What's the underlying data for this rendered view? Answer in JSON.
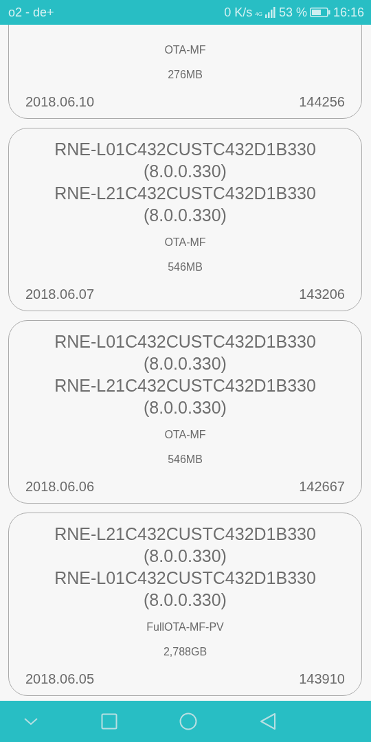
{
  "status_bar": {
    "carrier": "o2 - de+",
    "speed": "0 K/s",
    "network": "4G",
    "battery": "53 %",
    "time": "16:16"
  },
  "cards": [
    {
      "type": "OTA-MF",
      "size": "276MB",
      "date": "2018.06.10",
      "number": "144256"
    },
    {
      "title_lines": [
        "RNE-L01C432CUSTC432D1B330",
        "(8.0.0.330)",
        "RNE-L21C432CUSTC432D1B330",
        "(8.0.0.330)"
      ],
      "type": "OTA-MF",
      "size": "546MB",
      "date": "2018.06.07",
      "number": "143206"
    },
    {
      "title_lines": [
        "RNE-L01C432CUSTC432D1B330",
        "(8.0.0.330)",
        "RNE-L21C432CUSTC432D1B330",
        "(8.0.0.330)"
      ],
      "type": "OTA-MF",
      "size": "546MB",
      "date": "2018.06.06",
      "number": "142667"
    },
    {
      "title_lines": [
        "RNE-L21C432CUSTC432D1B330",
        "(8.0.0.330)",
        "RNE-L01C432CUSTC432D1B330",
        "(8.0.0.330)"
      ],
      "type": "FullOTA-MF-PV",
      "size": "2,788GB",
      "date": "2018.06.05",
      "number": "143910"
    }
  ]
}
